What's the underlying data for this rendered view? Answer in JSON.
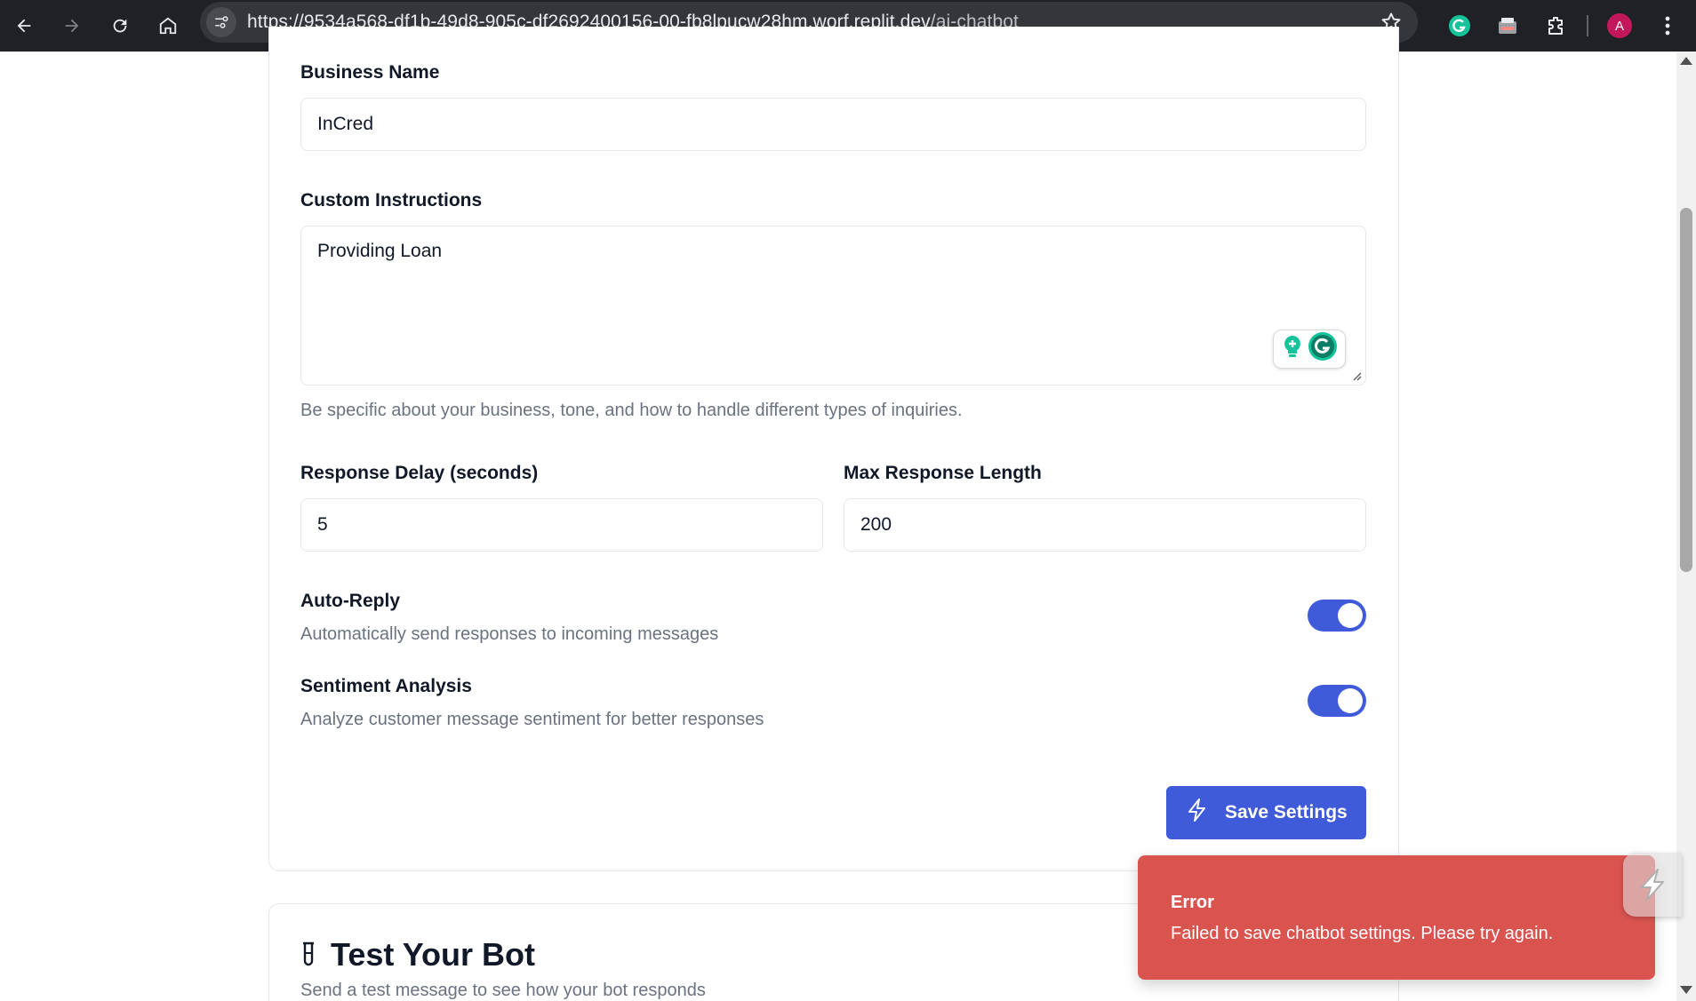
{
  "browser": {
    "url_host": "https://9534a568-df1b-49d8-905c-df2692400156-00-fb8lpucw28hm.worf.replit.dev",
    "url_path": "/ai-chatbot",
    "profile_initial": "A"
  },
  "form": {
    "business_name_label": "Business Name",
    "business_name_value": "InCred",
    "custom_instructions_label": "Custom Instructions",
    "custom_instructions_value": "Providing Loan",
    "custom_instructions_help": "Be specific about your business, tone, and how to handle different types of inquiries.",
    "response_delay_label": "Response Delay (seconds)",
    "response_delay_value": "5",
    "max_length_label": "Max Response Length",
    "max_length_value": "200",
    "auto_reply_label": "Auto-Reply",
    "auto_reply_desc": "Automatically send responses to incoming messages",
    "auto_reply_on": true,
    "sentiment_label": "Sentiment Analysis",
    "sentiment_desc": "Analyze customer message sentiment for better responses",
    "sentiment_on": true,
    "save_label": "Save Settings"
  },
  "test_bot": {
    "title": "Test Your Bot",
    "subtitle": "Send a test message to see how your bot responds"
  },
  "toast": {
    "title": "Error",
    "message": "Failed to save chatbot settings. Please try again."
  },
  "colors": {
    "primary": "#3f5bd9",
    "error": "#d9534f"
  }
}
